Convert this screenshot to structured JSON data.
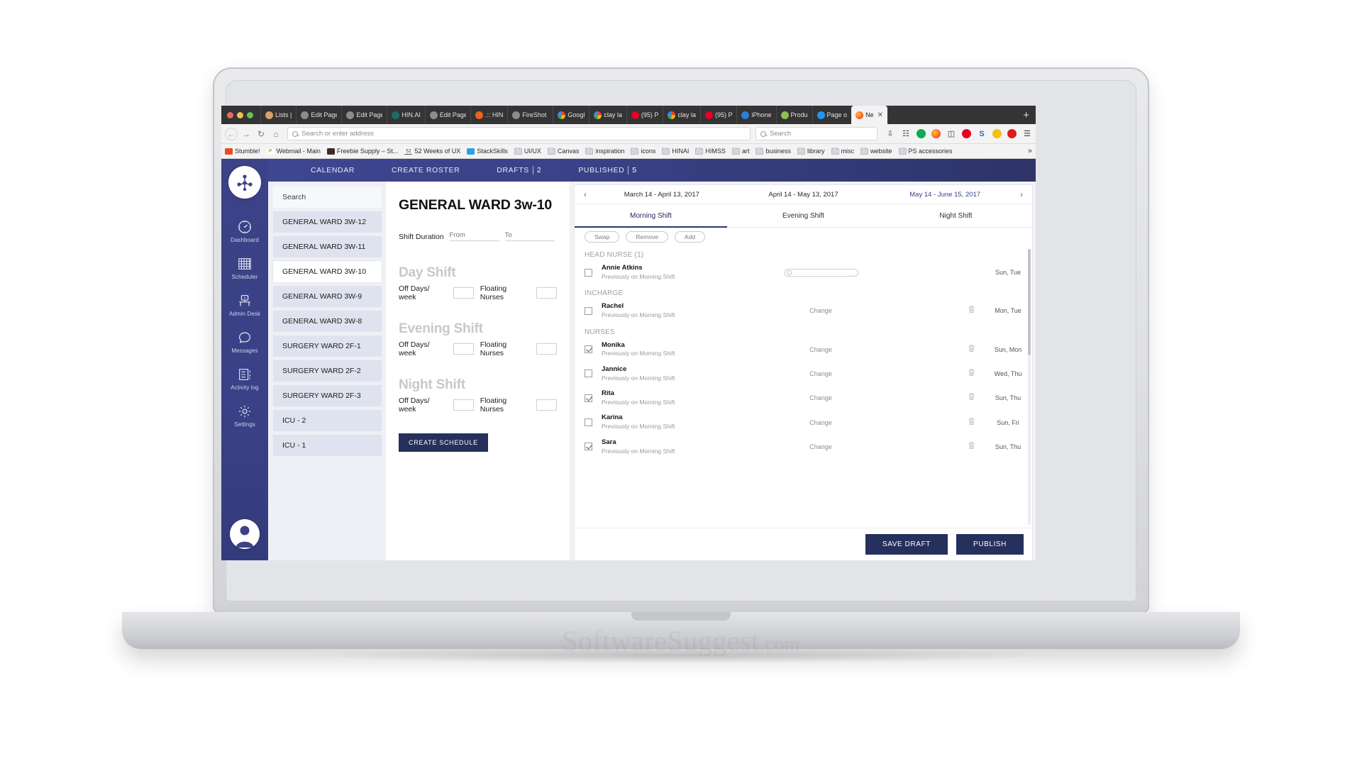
{
  "browser": {
    "tabs": [
      {
        "label": "Lists |",
        "icon": "person-favicon",
        "active": false
      },
      {
        "label": "Edit Page",
        "icon": "generic-favicon",
        "active": false
      },
      {
        "label": "Edit Page",
        "icon": "generic-favicon",
        "active": false
      },
      {
        "label": "HIN.AI",
        "icon": "teal-favicon",
        "active": false
      },
      {
        "label": "Edit Page",
        "icon": "generic-favicon",
        "active": false
      },
      {
        "label": ".:: HIN",
        "icon": "orange-favicon",
        "active": false
      },
      {
        "label": "FireShot C",
        "icon": "generic-favicon",
        "active": false
      },
      {
        "label": "Googl",
        "icon": "google-favicon",
        "active": false
      },
      {
        "label": "clay la",
        "icon": "google-favicon",
        "active": false
      },
      {
        "label": "(95) P",
        "icon": "pinterest-favicon",
        "active": false
      },
      {
        "label": "clay la",
        "icon": "google-favicon",
        "active": false
      },
      {
        "label": "(95) P",
        "icon": "pinterest-favicon",
        "active": false
      },
      {
        "label": "iPhone",
        "icon": "dribbble-favicon",
        "active": false
      },
      {
        "label": "Produ",
        "icon": "leaf-favicon",
        "active": false
      },
      {
        "label": "Page o",
        "icon": "blue-favicon",
        "active": false
      },
      {
        "label": "Ne",
        "icon": "firefox-favicon",
        "active": true
      }
    ],
    "new_tab_label": "+",
    "toolbar": {
      "back_label": "←",
      "forward_label": "→",
      "reload_label": "↻",
      "home_label": "⌂",
      "url_placeholder": "Search or enter address",
      "url_value": "",
      "search_placeholder": "Search",
      "search_value": "",
      "icons": [
        "download-icon",
        "library-icon",
        "green-circle-icon",
        "firefox-account-icon",
        "reader-icon",
        "pinterest-icon",
        "s-extension-icon",
        "lightbulb-icon",
        "record-icon",
        "hamburger-menu-icon"
      ]
    },
    "bookmarks": [
      {
        "label": "Stumble!",
        "icon": "stumbleupon-icon"
      },
      {
        "label": "Webmail - Main",
        "icon": "webmail-icon"
      },
      {
        "label": "Freebie Supply – St...",
        "icon": "freebie-icon"
      },
      {
        "label": "52 Weeks of UX",
        "icon": "52weeks-icon"
      },
      {
        "label": "StackSkills",
        "icon": "stackskills-icon"
      },
      {
        "label": "UI/UX",
        "icon": "folder-icon"
      },
      {
        "label": "Canvas",
        "icon": "folder-icon"
      },
      {
        "label": "inspiration",
        "icon": "folder-icon"
      },
      {
        "label": "icons",
        "icon": "folder-icon"
      },
      {
        "label": "HINAI",
        "icon": "folder-icon"
      },
      {
        "label": "HIMSS",
        "icon": "folder-icon"
      },
      {
        "label": "art",
        "icon": "folder-icon"
      },
      {
        "label": "business",
        "icon": "folder-icon"
      },
      {
        "label": "library",
        "icon": "folder-icon"
      },
      {
        "label": "misc",
        "icon": "folder-icon"
      },
      {
        "label": "website",
        "icon": "folder-icon"
      },
      {
        "label": "PS accessories",
        "icon": "folder-icon"
      }
    ],
    "bookmarks_overflow_label": "»"
  },
  "app": {
    "topnav": [
      {
        "label": "CALENDAR",
        "count": null
      },
      {
        "label": "CREATE ROSTER",
        "count": null
      },
      {
        "label": "DRAFTS",
        "count": "2"
      },
      {
        "label": "PUBLISHED",
        "count": "5"
      }
    ],
    "rail": [
      {
        "label": "Dashboard",
        "icon": "dashboard-icon"
      },
      {
        "label": "Scheduler",
        "icon": "grid-icon"
      },
      {
        "label": "Admin Desk",
        "icon": "desk-icon"
      },
      {
        "label": "Messages",
        "icon": "chat-icon"
      },
      {
        "label": "Activity log",
        "icon": "list-icon"
      },
      {
        "label": "Settings",
        "icon": "gear-icon"
      }
    ],
    "wards": {
      "search_placeholder": "Search",
      "search_value": "",
      "items": [
        {
          "label": "GENERAL WARD 3W-12",
          "active": false
        },
        {
          "label": "GENERAL WARD 3W-11",
          "active": false
        },
        {
          "label": "GENERAL WARD 3W-10",
          "active": true
        },
        {
          "label": "GENERAL WARD 3W-9",
          "active": false
        },
        {
          "label": "GENERAL WARD 3W-8",
          "active": false
        },
        {
          "label": "SURGERY WARD 2F-1",
          "active": false
        },
        {
          "label": "SURGERY WARD 2F-2",
          "active": false
        },
        {
          "label": "SURGERY WARD 2F-3",
          "active": false
        },
        {
          "label": "ICU - 2",
          "active": false
        },
        {
          "label": "ICU - 1",
          "active": false
        }
      ]
    },
    "form": {
      "title": "GENERAL WARD 3w-10",
      "shift_duration_label": "Shift Duration",
      "from_placeholder": "From",
      "from_value": "",
      "to_placeholder": "To",
      "to_value": "",
      "sections": [
        {
          "heading": "Day Shift",
          "off_days_label": "Off Days/ week",
          "off_days_value": "",
          "floating_label": "Floating Nurses",
          "floating_value": ""
        },
        {
          "heading": "Evening Shift",
          "off_days_label": "Off Days/ week",
          "off_days_value": "",
          "floating_label": "Floating Nurses",
          "floating_value": ""
        },
        {
          "heading": "Night Shift",
          "off_days_label": "Off Days/ week",
          "off_days_value": "",
          "floating_label": "Floating Nurses",
          "floating_value": ""
        }
      ],
      "create_button": "CREATE SCHEDULE"
    },
    "roster": {
      "prev_label": "‹",
      "next_label": "›",
      "date_ranges": [
        {
          "label": "March 14 - April 13, 2017",
          "current": false
        },
        {
          "label": "April 14 - May 13, 2017",
          "current": false
        },
        {
          "label": "May 14 - June 15, 2017",
          "current": true
        }
      ],
      "shift_tabs": [
        {
          "label": "Morning Shift",
          "active": true
        },
        {
          "label": "Evening Shift",
          "active": false
        },
        {
          "label": "Night Shift",
          "active": false
        }
      ],
      "actions": [
        "Swap",
        "Remove",
        "Add"
      ],
      "groups": [
        {
          "heading": "HEAD NURSE (1)",
          "rows": [
            {
              "name": "Annie Atkins",
              "sub": "Previously on Morning Shift",
              "checked": false,
              "control": "progress",
              "change_label": "",
              "days": "Sun, Tue",
              "trash": false
            }
          ]
        },
        {
          "heading": "INCHARGE",
          "rows": [
            {
              "name": "Rachel",
              "sub": "Previously on Morning Shift",
              "checked": false,
              "control": "change",
              "change_label": "Change",
              "days": "Mon, Tue",
              "trash": true
            }
          ]
        },
        {
          "heading": "NURSES",
          "rows": [
            {
              "name": "Monika",
              "sub": "Previously on Morning Shift",
              "checked": true,
              "control": "change",
              "change_label": "Change",
              "days": "Sun, Mon",
              "trash": true
            },
            {
              "name": "Jannice",
              "sub": "Previously on Morning Shift",
              "checked": false,
              "control": "change",
              "change_label": "Change",
              "days": "Wed, Thu",
              "trash": true
            },
            {
              "name": "Rita",
              "sub": "Previously on Morning Shift",
              "checked": true,
              "control": "change",
              "change_label": "Change",
              "days": "Sun, Thu",
              "trash": true
            },
            {
              "name": "Karina",
              "sub": "Previously on Morning Shift",
              "checked": false,
              "control": "change",
              "change_label": "Change",
              "days": "Sun, Fri",
              "trash": true
            },
            {
              "name": "Sara",
              "sub": "Previously on Morning Shift",
              "checked": true,
              "control": "change",
              "change_label": "Change",
              "days": "Sun, Thu",
              "trash": true
            }
          ]
        }
      ],
      "save_draft_label": "SAVE DRAFT",
      "publish_label": "PUBLISH"
    }
  },
  "watermark": {
    "brand": "SoftwareSuggest",
    "domain": ".com"
  },
  "colors": {
    "brand_navy": "#26305c",
    "rail_purple": "#3b4287",
    "accent": "#39408a"
  }
}
